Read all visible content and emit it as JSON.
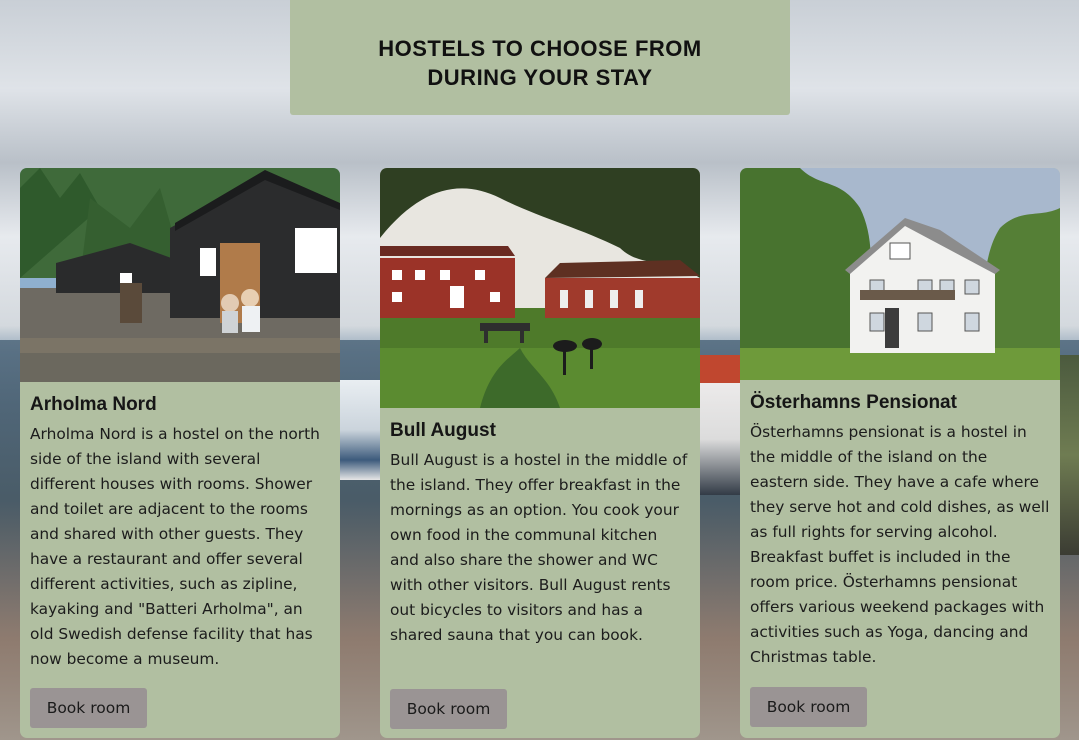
{
  "header": {
    "title": "HOSTELS TO CHOOSE FROM DURING YOUR STAY"
  },
  "hostels": [
    {
      "name": "Arholma Nord",
      "image_alt": "Arholma Nord hostel photo",
      "description": "Arholma Nord is a hostel on the north side of the island with several different houses with rooms. Shower and toilet are adjacent to the rooms and shared with other guests. They have a restaurant and offer several different activities, such as zipline, kayaking and \"Batteri Arholma\", an old Swedish defense facility that has now become a museum.",
      "button_label": "Book room"
    },
    {
      "name": "Bull August",
      "image_alt": "Bull August hostel photo",
      "description": "Bull August is a hostel in the middle of the island. They offer breakfast in the mornings as an option. You cook your own food in the communal kitchen and also share the shower and WC with other visitors. Bull August rents out bicycles to visitors and has a shared sauna that you can book.",
      "button_label": "Book room"
    },
    {
      "name": "Österhamns Pensionat",
      "image_alt": "Österhamns Pensionat photo",
      "description": "Österhamns pensionat is a hostel in the middle of the island on the eastern side. They have a cafe where they serve hot and cold dishes, as well as full rights for serving alcohol. Breakfast buffet is included in the room price. Österhamns pensionat offers various weekend packages with activities such as Yoga, dancing and Christmas table.",
      "button_label": "Book room"
    }
  ],
  "colors": {
    "card_bg": "#b1bfa1",
    "button_bg": "#9a9494"
  }
}
